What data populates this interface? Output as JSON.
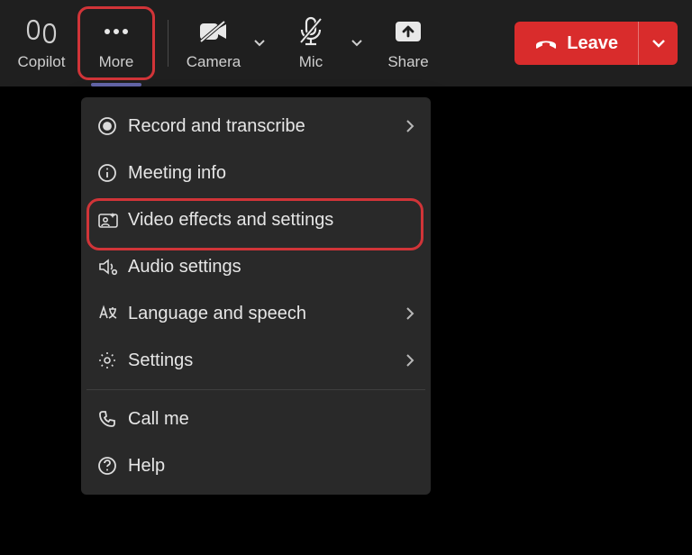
{
  "toolbar": {
    "copilot": "Copilot",
    "more": "More",
    "camera": "Camera",
    "mic": "Mic",
    "share": "Share",
    "leave": "Leave"
  },
  "menu": {
    "record": "Record and transcribe",
    "meeting_info": "Meeting info",
    "video_effects": "Video effects and settings",
    "audio_settings": "Audio settings",
    "language_speech": "Language and speech",
    "settings": "Settings",
    "call_me": "Call me",
    "help": "Help"
  }
}
